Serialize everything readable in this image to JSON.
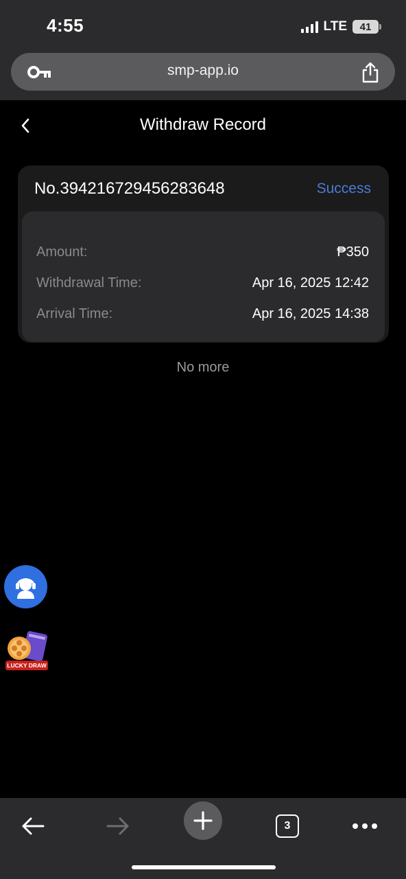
{
  "status_bar": {
    "time": "4:55",
    "network": "LTE",
    "battery": "41"
  },
  "browser": {
    "url": "smp-app.io",
    "tab_count": "3"
  },
  "page": {
    "title": "Withdraw Record"
  },
  "record": {
    "number": "No.394216729456283648",
    "status": "Success",
    "amount_label": "Amount:",
    "amount_value": "₱350",
    "withdrawal_time_label": "Withdrawal Time:",
    "withdrawal_time_value": "Apr 16, 2025 12:42",
    "arrival_time_label": "Arrival Time:",
    "arrival_time_value": "Apr 16, 2025 14:38"
  },
  "list_end_text": "No more",
  "floating": {
    "lucky_draw_label": "LUCKY DRAW"
  },
  "colors": {
    "accent": "#4b7bd8",
    "support": "#2f6fe0",
    "lucky_red": "#c8201c"
  },
  "icons": [
    "key-icon",
    "share-icon",
    "back-chevron-icon",
    "headset-support-icon",
    "film-reel-icon",
    "arrow-left-icon",
    "arrow-right-icon",
    "plus-icon",
    "more-dots-icon"
  ]
}
